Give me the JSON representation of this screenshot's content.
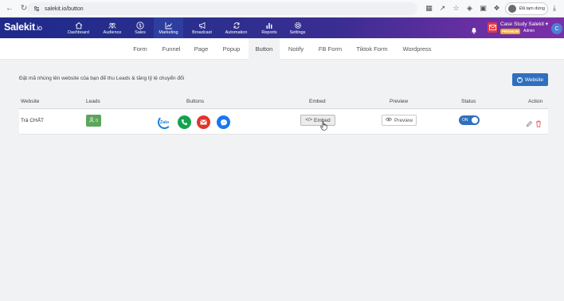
{
  "browser": {
    "url": "salekit.io/button",
    "profile_status": "Đã tạm dừng"
  },
  "navbar": {
    "brand": "Salekit",
    "brand_suffix": ".io",
    "items": [
      {
        "label": "Dashboard",
        "icon": "home-icon"
      },
      {
        "label": "Audience",
        "icon": "users-icon"
      },
      {
        "label": "Sales",
        "icon": "dollar-icon"
      },
      {
        "label": "Marketing",
        "icon": "chart-line-icon",
        "active": true
      },
      {
        "label": "Broadcast",
        "icon": "megaphone-icon"
      },
      {
        "label": "Automation",
        "icon": "sync-icon"
      },
      {
        "label": "Reports",
        "icon": "bar-chart-icon"
      },
      {
        "label": "Settings",
        "icon": "gear-icon"
      }
    ],
    "user": {
      "name": "Case Study Salekit",
      "plan": "PREMIUM",
      "role": "Admin",
      "avatar_letter": "C"
    }
  },
  "subtabs": [
    "Form",
    "Funnel",
    "Page",
    "Popup",
    "Button",
    "Notify",
    "FB Form",
    "Tiktok Form",
    "Wordpress"
  ],
  "active_subtab": "Button",
  "page": {
    "description": "Đặt mã nhúng lên website của bạn để thu Leads & tăng tỷ lệ chuyển đổi",
    "add_button": "Website"
  },
  "table": {
    "headers": [
      "Website",
      "Leads",
      "Buttons",
      "Embed",
      "Preview",
      "Status",
      "Action"
    ],
    "rows": [
      {
        "website": "Trà CHẤT",
        "leads": "0",
        "buttons": [
          "zalo-icon",
          "phone-icon",
          "mail-icon",
          "messenger-icon"
        ],
        "zalo_text": "Zalo",
        "embed_label": "Embed",
        "preview_label": "Preview",
        "status": "ON"
      }
    ]
  },
  "colors": {
    "primary": "#2f6fbf",
    "leads_badge": "#5ba65a",
    "zalo": "#1c7ed6",
    "phone": "#13a34e",
    "mail": "#e0352b",
    "messenger": "#1877f2",
    "premium": "#f4a51c"
  }
}
